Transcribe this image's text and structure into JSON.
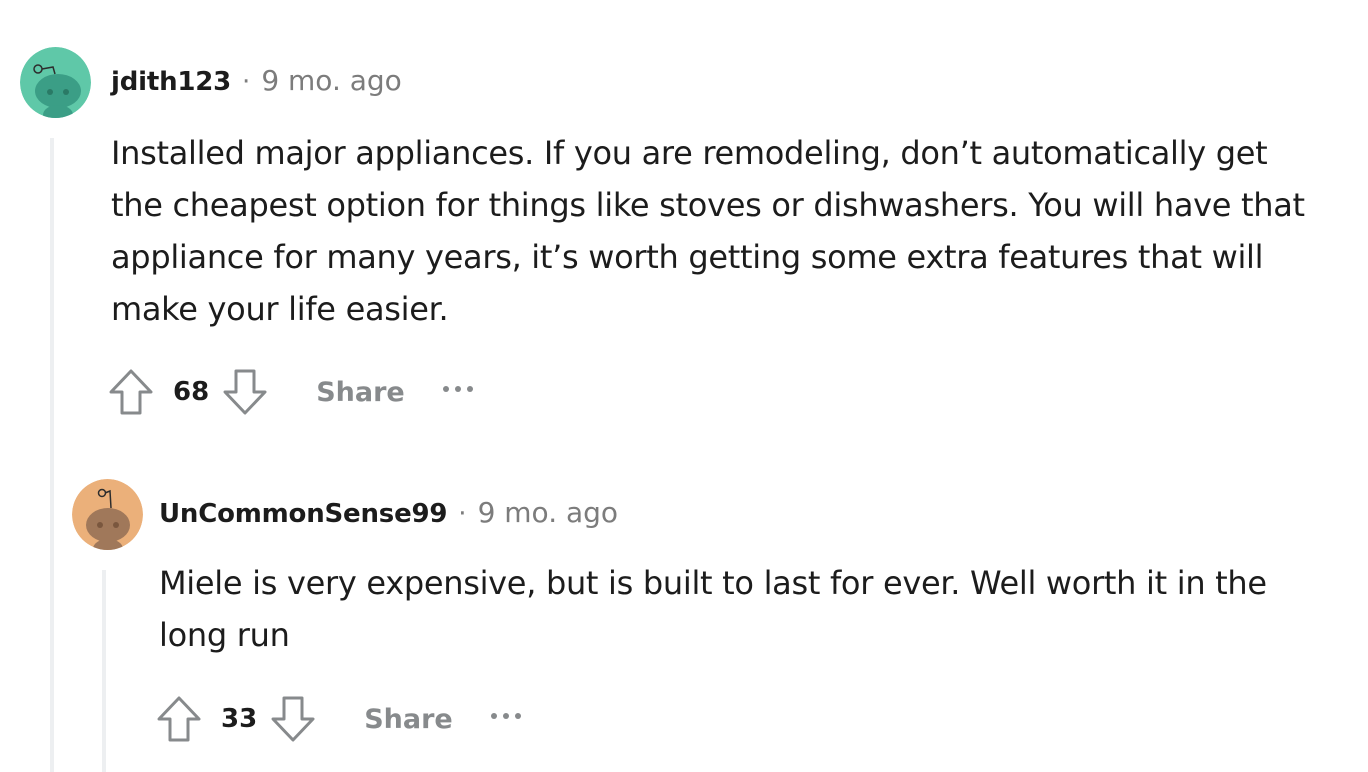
{
  "comments": [
    {
      "username": "jdith123",
      "separator": "·",
      "timestamp": "9 mo. ago",
      "body_lines": [
        "Installed major appliances. If you are remodeling, don’t automatically get",
        "the cheapest option for things like stoves or dishwashers. You will have that",
        "appliance for many years, it’s worth getting some extra features that will",
        "make your life easier."
      ],
      "score": "68",
      "share_label": "Share",
      "avatar_color": "#5fc8a8",
      "avatar_icon": "snoo-avatar-icon"
    },
    {
      "username": "UnCommonSense99",
      "separator": "·",
      "timestamp": "9 mo. ago",
      "body_lines": [
        "Miele is very expensive, but is built to last for ever. Well worth it in the",
        "long run"
      ],
      "score": "33",
      "share_label": "Share",
      "avatar_color": "#ebb07a",
      "avatar_icon": "snoo-avatar-icon"
    }
  ],
  "colors": {
    "text": "#1c1c1c",
    "meta": "#7c7c7c",
    "action": "#878a8c",
    "thread_line": "#edeff1"
  }
}
